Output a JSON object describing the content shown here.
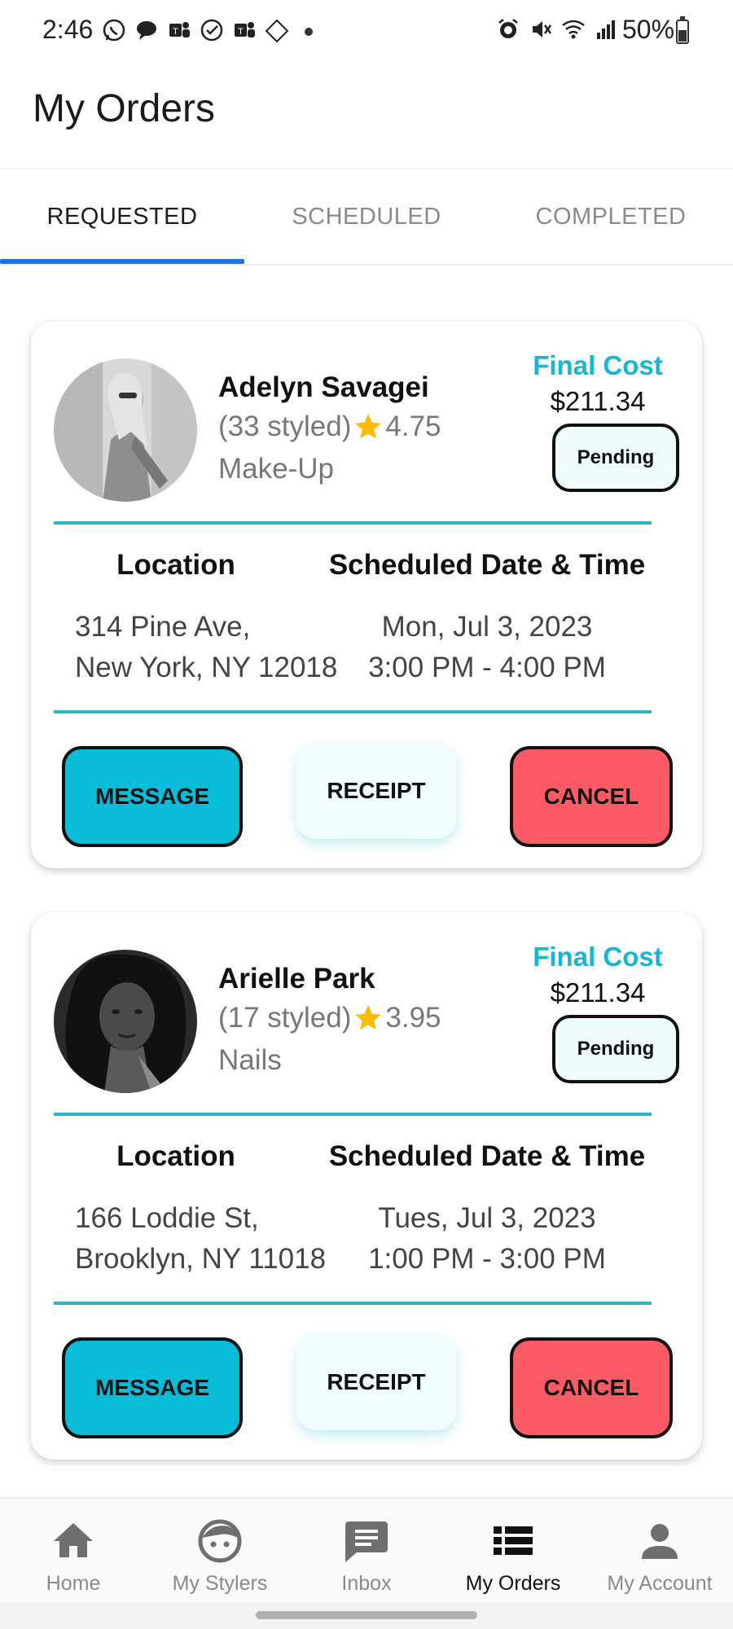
{
  "status_bar": {
    "time": "2:46",
    "left_icons": [
      "whatsapp-icon",
      "chat-icon",
      "teams-icon",
      "check-circle-icon",
      "teams-icon",
      "adt-icon"
    ],
    "right_icons": [
      "alarm-icon",
      "mute-icon",
      "wifi-icon",
      "signal-icon"
    ],
    "battery": "50%"
  },
  "header": {
    "title": "My Orders"
  },
  "tabs": [
    {
      "label": "REQUESTED",
      "active": true
    },
    {
      "label": "SCHEDULED",
      "active": false
    },
    {
      "label": "COMPLETED",
      "active": false
    }
  ],
  "orders": [
    {
      "stylist_name": "Adelyn Savagei",
      "styled_count": "(33 styled)",
      "rating": "4.75",
      "service": "Make-Up",
      "final_cost_label": "Final Cost",
      "final_cost": "$211.34",
      "status": "Pending",
      "location_heading": "Location",
      "datetime_heading": "Scheduled Date & Time",
      "address_line1": "314 Pine Ave,",
      "address_line2": "New York, NY 12018",
      "date": "Mon, Jul 3, 2023",
      "time": "3:00 PM - 4:00 PM",
      "message_label": "MESSAGE",
      "receipt_label": "RECEIPT",
      "cancel_label": "CANCEL"
    },
    {
      "stylist_name": "Arielle Park",
      "styled_count": "(17 styled)",
      "rating": "3.95",
      "service": "Nails",
      "final_cost_label": "Final Cost",
      "final_cost": "$211.34",
      "status": "Pending",
      "location_heading": "Location",
      "datetime_heading": "Scheduled Date & Time",
      "address_line1": "166 Loddie St,",
      "address_line2": "Brooklyn, NY 11018",
      "date": "Tues, Jul 3, 2023",
      "time": "1:00 PM - 3:00 PM",
      "message_label": "MESSAGE",
      "receipt_label": "RECEIPT",
      "cancel_label": "CANCEL"
    }
  ],
  "bottom_nav": [
    {
      "label": "Home",
      "icon": "home-icon",
      "active": false
    },
    {
      "label": "My Stylers",
      "icon": "face-icon",
      "active": false
    },
    {
      "label": "Inbox",
      "icon": "chat-bubble-icon",
      "active": false
    },
    {
      "label": "My Orders",
      "icon": "list-icon",
      "active": true
    },
    {
      "label": "My Account",
      "icon": "person-icon",
      "active": false
    }
  ],
  "colors": {
    "accent_cyan": "#19b6cf",
    "message_button": "#09bcd8",
    "cancel_button": "#fc5b66",
    "tab_indicator": "#1a73e8",
    "star": "#fbbc05"
  }
}
